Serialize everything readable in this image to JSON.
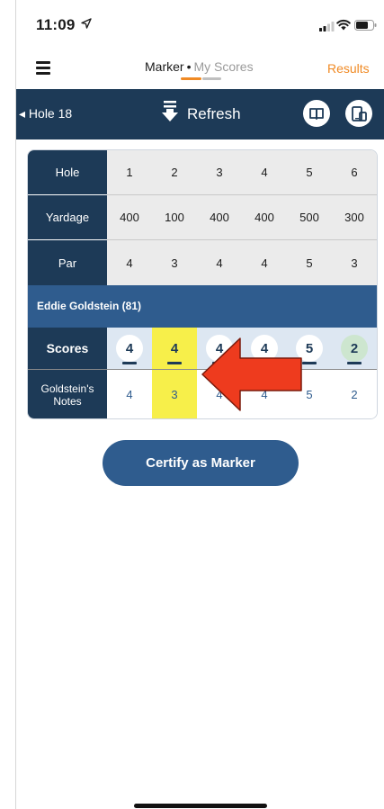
{
  "status_bar": {
    "time": "11:09"
  },
  "header": {
    "marker_label": "Marker",
    "separator": "•",
    "my_scores_label": "My Scores",
    "results_label": "Results",
    "accent_color": "#f08a24"
  },
  "nav": {
    "hole_label": "◂ Hole 18",
    "refresh_label": "Refresh",
    "bar_color": "#1d3a57"
  },
  "scorecard": {
    "hole_label": "Hole",
    "yardage_label": "Yardage",
    "par_label": "Par",
    "holes": [
      "1",
      "2",
      "3",
      "4",
      "5",
      "6"
    ],
    "yardage": [
      "400",
      "100",
      "400",
      "400",
      "500",
      "300"
    ],
    "par": [
      "4",
      "3",
      "4",
      "4",
      "5",
      "3"
    ],
    "player": "Eddie Goldstein  (81)",
    "scores_label": "Scores",
    "scores": [
      "4",
      "4",
      "4",
      "4",
      "5",
      "2"
    ],
    "notes_label": "Goldstein's Notes",
    "notes": [
      "4",
      "3",
      "4",
      "4",
      "5",
      "2"
    ],
    "highlight_color": "#f7ef4a",
    "green_color": "#cde6cf"
  },
  "actions": {
    "certify_label": "Certify as Marker"
  },
  "icons": [
    "location-arrow-icon",
    "signal-icon",
    "wifi-icon",
    "battery-icon",
    "hamburger-menu-icon",
    "refresh-arrow-icon",
    "book-icon",
    "device-icon",
    "red-arrow-annotation"
  ]
}
